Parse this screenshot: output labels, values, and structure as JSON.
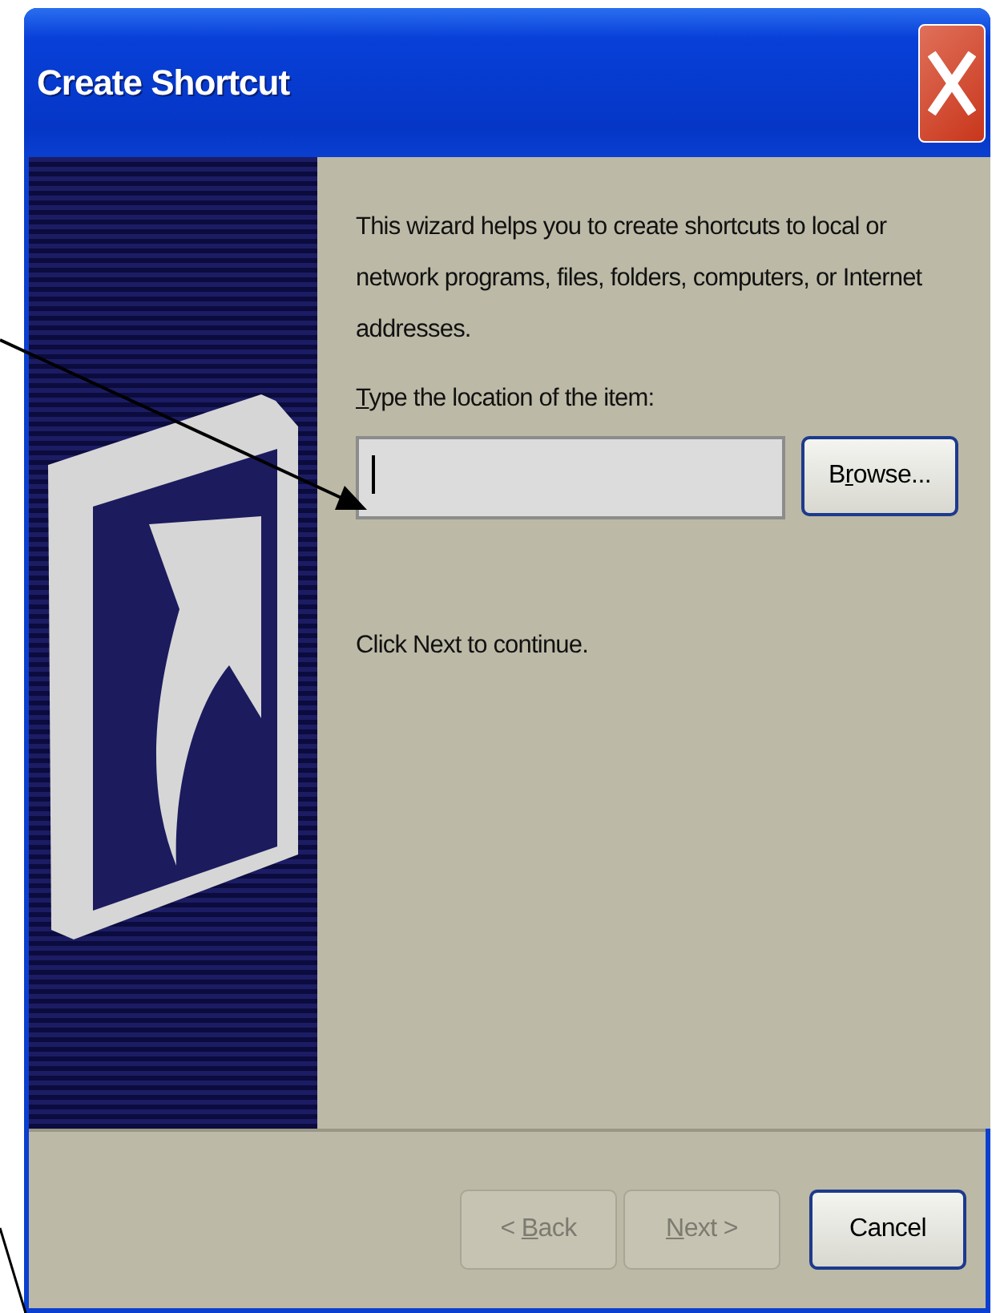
{
  "window": {
    "title": "Create Shortcut"
  },
  "intro": "This wizard helps you to create shortcuts to local or network programs, files, folders, computers, or Internet addresses.",
  "location": {
    "label_parts": [
      {
        "text": "T",
        "access_key": true
      },
      {
        "text": "ype the location of the item:",
        "access_key": false
      }
    ],
    "focused": true
  },
  "browse_button": {
    "parts": [
      {
        "text": "B",
        "access_key": false
      },
      {
        "text": "r",
        "access_key": true
      },
      {
        "text": "owse...",
        "access_key": false
      }
    ],
    "disabled": false
  },
  "hint": "Click Next to continue.",
  "buttons": [
    {
      "parts": [
        {
          "text": "< ",
          "access_key": false
        },
        {
          "text": "B",
          "access_key": true
        },
        {
          "text": "ack",
          "access_key": false
        }
      ],
      "disabled": true
    },
    {
      "parts": [
        {
          "text": "N",
          "access_key": true
        },
        {
          "text": "ext >",
          "access_key": false
        }
      ],
      "disabled": true
    },
    {
      "parts": [
        {
          "text": "Cancel",
          "access_key": false
        }
      ],
      "disabled": false
    }
  ]
}
